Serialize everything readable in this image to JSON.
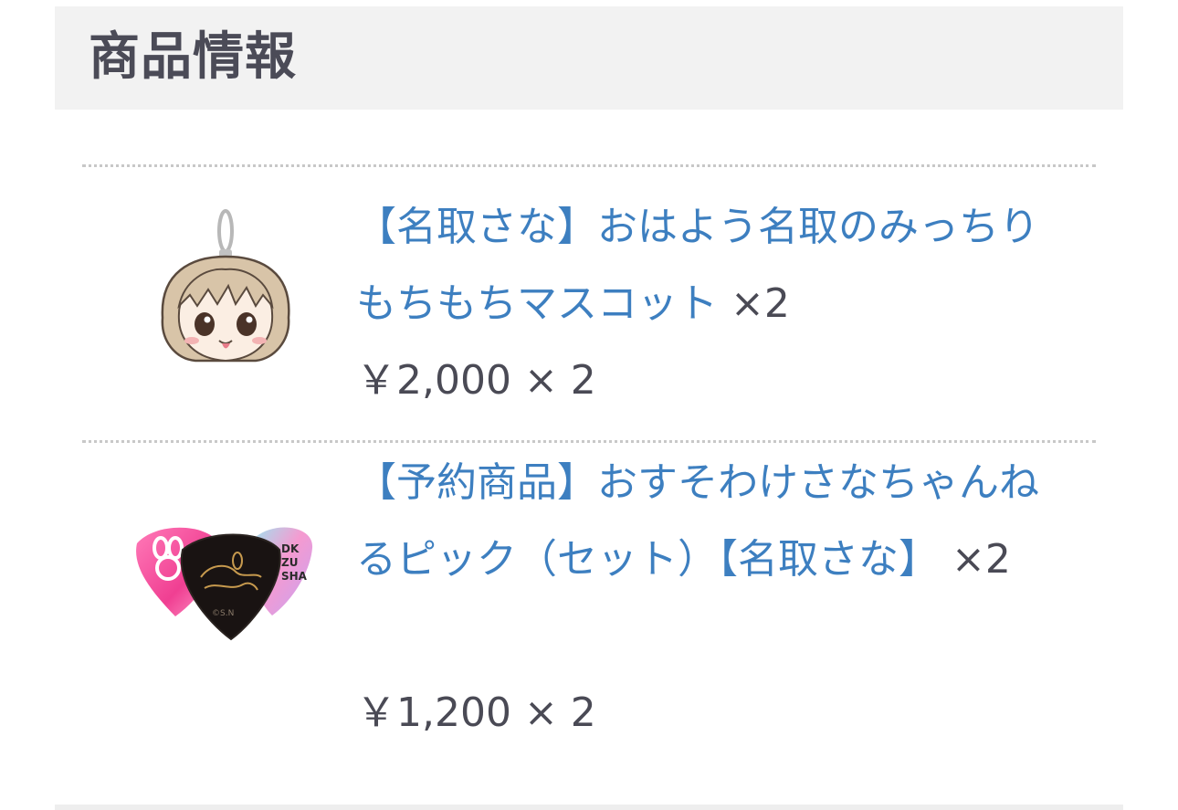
{
  "section": {
    "title": "商品情報"
  },
  "items": [
    {
      "name": "【名取さな】おはよう名取のみっちりもちもちマスコット",
      "quantity_suffix": "×2",
      "price": "￥2,000 × 2",
      "image_icon": "mascot-keychain-image"
    },
    {
      "name": "【予約商品】おすそわけさなちゃんねるピック（セット）【名取さな】",
      "quantity_suffix": "×2",
      "price": "￥1,200 × 2",
      "image_icon": "guitar-pick-set-image"
    }
  ],
  "colors": {
    "link": "#3d7fc0",
    "text": "#4a4a55",
    "header_bg": "#f2f2f2"
  }
}
